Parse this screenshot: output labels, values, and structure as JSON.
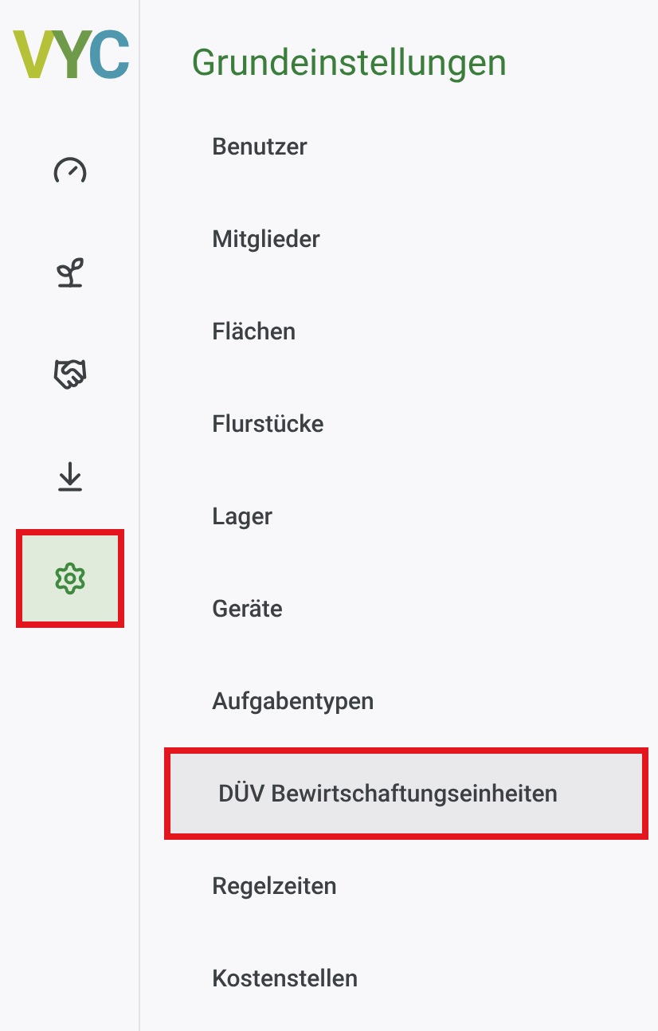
{
  "logo": "VYC",
  "nav": [
    {
      "kind": "dashboard",
      "selected": false,
      "highlighted": false
    },
    {
      "kind": "plants",
      "selected": false,
      "highlighted": false
    },
    {
      "kind": "handshake",
      "selected": false,
      "highlighted": false
    },
    {
      "kind": "download",
      "selected": false,
      "highlighted": false
    },
    {
      "kind": "settings",
      "selected": true,
      "highlighted": true
    }
  ],
  "title": "Grundeinstellungen",
  "menu": [
    {
      "label": "Benutzer",
      "selected": false,
      "highlighted": false
    },
    {
      "label": "Mitglieder",
      "selected": false,
      "highlighted": false
    },
    {
      "label": "Flächen",
      "selected": false,
      "highlighted": false
    },
    {
      "label": "Flurstücke",
      "selected": false,
      "highlighted": false
    },
    {
      "label": "Lager",
      "selected": false,
      "highlighted": false
    },
    {
      "label": "Geräte",
      "selected": false,
      "highlighted": false
    },
    {
      "label": "Aufgabentypen",
      "selected": false,
      "highlighted": false
    },
    {
      "label": "DÜV Bewirtschaftungseinheiten",
      "selected": true,
      "highlighted": true
    },
    {
      "label": "Regelzeiten",
      "selected": false,
      "highlighted": false
    },
    {
      "label": "Kostenstellen",
      "selected": false,
      "highlighted": false
    }
  ]
}
